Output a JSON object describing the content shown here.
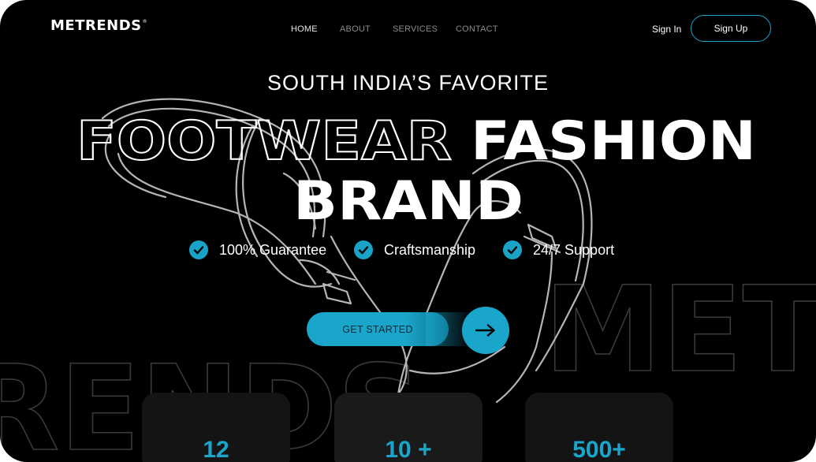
{
  "brand": {
    "name": "METRENDS",
    "mark": "®"
  },
  "nav": {
    "items": [
      {
        "label": "HOME",
        "active": true
      },
      {
        "label": "ABOUT",
        "active": false
      },
      {
        "label": "SERVICES",
        "active": false
      },
      {
        "label": "CONTACT",
        "active": false
      }
    ]
  },
  "auth": {
    "signin": "Sign In",
    "signup": "Sign Up"
  },
  "hero": {
    "tagline": "SOUTH INDIA’S FAVORITE",
    "headline_outline": "FOOTWEAR",
    "headline_solid_1": "FASHION",
    "headline_solid_2": "BRAND",
    "background_word_left": "RENDS",
    "background_word_right": "METRE",
    "features": [
      "100% Guarantee",
      "Craftsmanship",
      "24/7 Support"
    ],
    "cta_label": "GET STARTED"
  },
  "stats": [
    {
      "value": "12"
    },
    {
      "value": "10 +"
    },
    {
      "value": "500+"
    }
  ],
  "colors": {
    "accent": "#1aa6cb",
    "background": "#000000",
    "text": "#ffffff"
  },
  "icons": {
    "feature": "check-circle-icon",
    "cta": "arrow-right-icon"
  }
}
